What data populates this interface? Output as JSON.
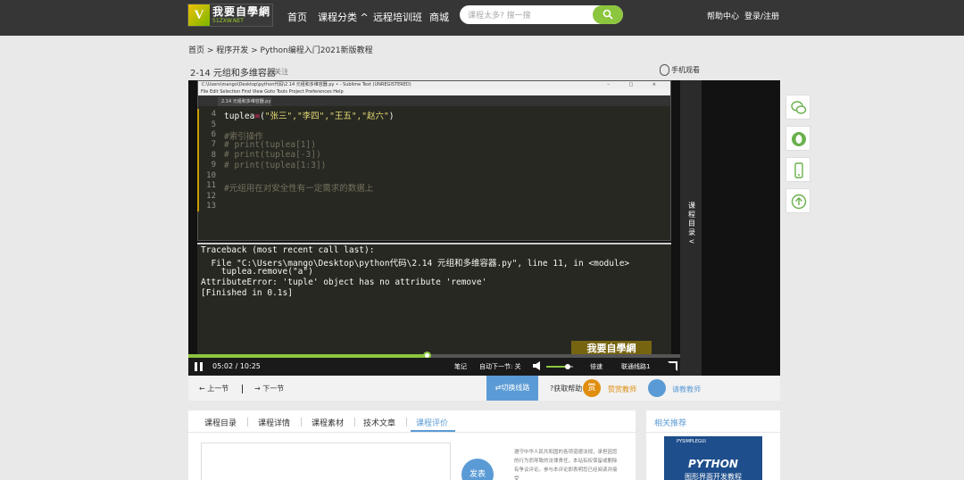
{
  "header": {
    "logo_text": "我要自學網",
    "logo_url": "51ZXW.NET",
    "nav": [
      "首页",
      "课程分类",
      "远程培训班",
      "商城"
    ],
    "search_placeholder": "课程太多? 搜一搜",
    "help": "帮助中心",
    "login": "登录/注册"
  },
  "breadcrumb": "首页 > 程序开发 > Python编程入门2021新版教程",
  "lesson": {
    "title": "2-14 元组和多维容器",
    "follow": "♡关注",
    "mobile": "手机观看"
  },
  "editor": {
    "title": "C:\\Users\\mango\\Desktop\\python代码\\2.14 元组和多维容器.py • - Sublime Text (UNREGISTERED)",
    "window_controls": "– □ ×",
    "menu": "File  Edit  Selection  Find  View  Goto  Tools  Project  Preferences  Help",
    "tab": "2.14 元组和多维容器.py",
    "line_numbers": [
      "4",
      "5",
      "6",
      "7",
      "8",
      "9",
      "10",
      "11",
      "12",
      "13"
    ],
    "code": {
      "l4_var": "tuplea",
      "l4_op": "=",
      "l4_open": "(",
      "l4_items": "\"张三\",\"李四\",\"王五\",\"赵六\"",
      "l4_close": ")",
      "l6": "#索引操作",
      "l7": "# print(tuplea[1])",
      "l8": "# print(tuplea[-3])",
      "l9": "# print(tuplea[1:3])",
      "l11": "#元组用在对安全性有一定需求的数据上"
    }
  },
  "console": [
    "Traceback (most recent call last):",
    "  File \"C:\\Users\\mango\\Desktop\\python代码\\2.14 元组和多维容器.py\", line 11, in <module>",
    "    tuplea.remove(\"a\")",
    "AttributeError: 'tuple' object has no attribute 'remove'",
    "[Finished in 0.1s]"
  ],
  "player": {
    "time": "05:02 / 10:25",
    "progress_fraction": 0.484,
    "volume_fraction": 0.8,
    "notes": "笔记",
    "autoplay": "自动下一节: 关",
    "speed": "倍速",
    "line": "联通线路1",
    "catalog": "课程目录",
    "watermark": "我要自學網"
  },
  "toolbar": {
    "prev": "← 上一节",
    "next": "→ 下一节",
    "switch": "切换线路",
    "help": "获取帮助",
    "praise_icon": "赏",
    "praise": "赞赏教师",
    "ask": "请教教师"
  },
  "tabs": [
    "课程目录",
    "课程详情",
    "课程素材",
    "技术文章",
    "课程评价"
  ],
  "comment": {
    "send": "发表",
    "notice": "遵守中华人民共和国的各项道德法规，承担因您的行为而导致的法律责任，本站有权保留或删除有争议评论。参与本评论即表明您已经阅读并接受"
  },
  "recommend": {
    "title": "相关推荐",
    "thumb_small": "PYSIMPLEGUI",
    "thumb_big": "PYTHON",
    "thumb_sub": "图形界面开发教程"
  },
  "colors": {
    "accent": "#5b9bd5",
    "green": "#8cc63f",
    "orange": "#e08e10"
  }
}
